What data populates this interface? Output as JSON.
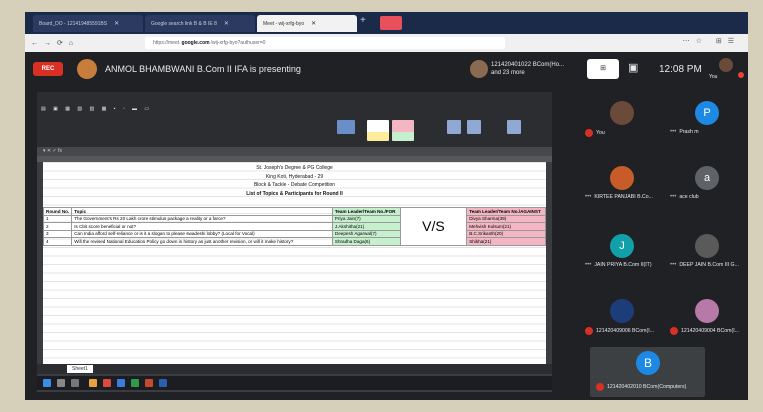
{
  "browser": {
    "tabs": [
      {
        "label": "Board_DO - 121419485591BS"
      },
      {
        "label": "Google search link B & B IE 8"
      },
      {
        "label": "Meet - wij-xrfg-byo",
        "active": true
      }
    ],
    "url_prefix": "https://meet.",
    "url_domain": "google.com",
    "url_suffix": "/wij-xrfg-byo?authuser=0"
  },
  "meet": {
    "rec_label": "REC",
    "presenting_text": "ANMOL BHAMBWANI B.Com II IFA is presenting",
    "caller_line1": "121420401022 BCom(Ho...",
    "caller_line2": "and 23 more",
    "clock": "12:08 PM",
    "you_label": "You"
  },
  "spreadsheet": {
    "heading_lines": [
      "St. Joseph's Degree & PG College",
      "King Koti, Hyderabad - 29",
      "Block & Tackle - Debate Competition",
      "List of Topics & Participants for Round II"
    ],
    "columns": [
      "Round No.",
      "Topic",
      "Team Leader/Team No./FOR",
      "",
      "Team Leader/Team No./AGAINST"
    ],
    "rows": [
      [
        "1",
        "The Government's Rs 20 Lakh crore stimulus package a reality or a farce?",
        "Priya Jain(7)",
        "Divya Sharma(39)"
      ],
      [
        "2",
        "Is Cbit score beneficial or not?",
        "J.Akshitha(21)",
        "Mehvish Kulsum(21)"
      ],
      [
        "3",
        "Can India afford self-reliance or is it a slogan to please swadeshi lobby? (Local for Vocal)",
        "Deepesh Agarwal(7)",
        "B.C.Srikanth(20)"
      ],
      [
        "4",
        "Will the revised National Education Policy go down in history as just another revision, or will it make history?",
        "Shradha Daga(6)",
        "Shikha(21)"
      ]
    ],
    "vs_label": "V/S",
    "sheet_tab": "Sheet1"
  },
  "participants": [
    {
      "name": "You",
      "initial": "",
      "color": "#6b4a3a"
    },
    {
      "name": "Prash m",
      "initial": "P",
      "color": "#1e88e5"
    },
    {
      "name": "KIRTEE PANJABI B.Co...",
      "initial": "",
      "color": "#c75b2a"
    },
    {
      "name": "ace club",
      "initial": "a",
      "color": "#5f6368"
    },
    {
      "name": "JAIN PRIYA B.Com II(IT)",
      "initial": "J",
      "color": "#12a0a8"
    },
    {
      "name": "DEEP JAIN B.Com III G...",
      "initial": "",
      "color": "#5a5a5a"
    },
    {
      "name": "121420409006 BCom(I...",
      "initial": "",
      "color": "#1d3d7a"
    },
    {
      "name": "121420409004 BCom(I...",
      "initial": "",
      "color": "#b77aa8"
    },
    {
      "name": "121420402010 BCom(Computers)",
      "initial": "B",
      "color": "#1e88e5"
    }
  ]
}
